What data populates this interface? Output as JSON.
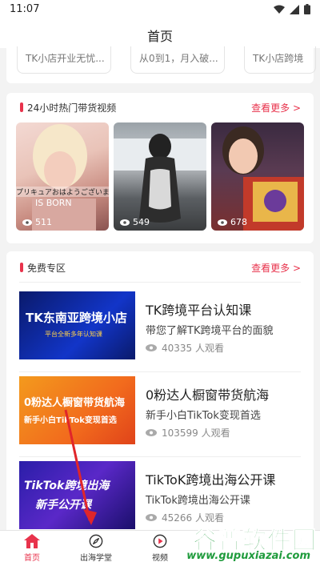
{
  "status": {
    "time": "11:07"
  },
  "header": {
    "title": "首页"
  },
  "top_chips": [
    "TK小店开业无忧...",
    "从0到1，月入破...",
    "TK小店跨境"
  ],
  "hot_videos": {
    "title": "24小时热门带货视频",
    "more": "查看更多 >",
    "items": [
      {
        "views": "511",
        "caption": "プリキュアおはようございます",
        "caption2": "IS BORN"
      },
      {
        "views": "549"
      },
      {
        "views": "678"
      }
    ]
  },
  "free_zone": {
    "title": "免费专区",
    "more": "查看更多 >",
    "courses": [
      {
        "title": "TK跨境平台认知课",
        "desc": "带您了解TK跨境平台的面貌",
        "views": "40335 人观看",
        "thumb_line1": "TK东南亚跨境小店",
        "thumb_line2": "平台全新多年认知课"
      },
      {
        "title": "0粉达人橱窗带货航海",
        "desc": "新手小白TikTok变现首选",
        "views": "103599 人观看",
        "thumb_line1": "0粉达人橱窗带货航海",
        "thumb_line2": "新手小白TikTok变现首选"
      },
      {
        "title": "TikToK跨境出海公开课",
        "desc": "TikTok跨境出海公开课",
        "views": "45266 人观看",
        "thumb_line1": "TikTok跨境出海",
        "thumb_line2": "新手公开课"
      }
    ]
  },
  "tabs": [
    {
      "label": "首页",
      "icon": "home-icon",
      "active": true
    },
    {
      "label": "出海学堂",
      "icon": "compass-icon",
      "active": false
    },
    {
      "label": "视频",
      "icon": "video-icon",
      "active": false
    }
  ],
  "watermark": {
    "title": "谷普软件园",
    "url": "www.gupuxiazai.com"
  },
  "colors": {
    "accent": "#e8334c",
    "watermark": "#1f9b3c",
    "background": "#f3f3f3"
  }
}
